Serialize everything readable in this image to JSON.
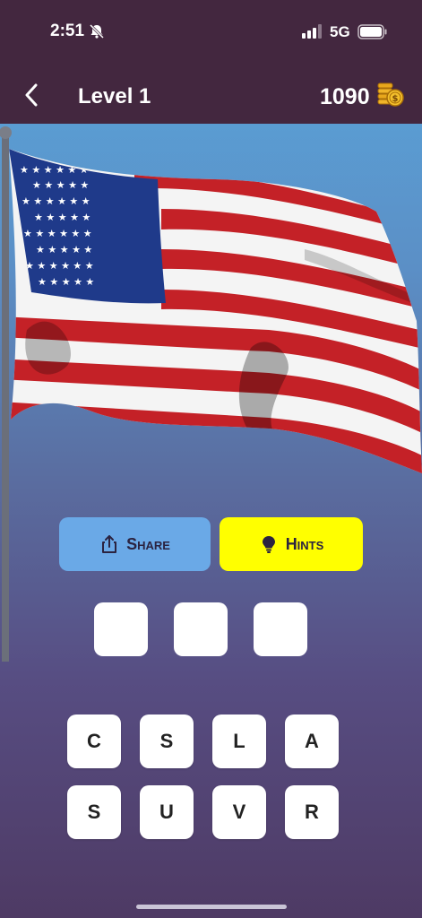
{
  "status": {
    "time": "2:51",
    "network": "5G"
  },
  "header": {
    "title": "Level 1",
    "coins": "1090",
    "coin_icon": "coin-stack-icon",
    "back_icon": "chevron-left-icon"
  },
  "actions": {
    "share_label": "Share",
    "hints_label": "Hints",
    "share_icon": "share-icon",
    "hints_icon": "lightbulb-icon"
  },
  "answer": {
    "slots": [
      "",
      "",
      ""
    ]
  },
  "letters": {
    "row1": [
      "C",
      "S",
      "L",
      "A"
    ],
    "row2": [
      "S",
      "U",
      "V",
      "R"
    ]
  },
  "colors": {
    "topbar": "#43273f",
    "share_button": "#6aa9e7",
    "hints_button": "#ffff00",
    "flag_red": "#c42127",
    "flag_blue": "#1f3a8a"
  }
}
